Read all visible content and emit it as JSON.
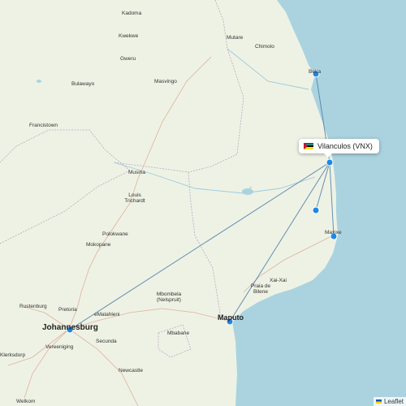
{
  "map": {
    "ocean_color": "#aad3df",
    "land_color": "#eef2e4",
    "route_color": "#4d7da8",
    "marker_color": "#1e88e5"
  },
  "popup": {
    "label": "Vilanculos (VNX)",
    "flag": "Mozambique flag"
  },
  "places": [
    {
      "name": "Kadoma"
    },
    {
      "name": "Kwekwe"
    },
    {
      "name": "Gweru"
    },
    {
      "name": "Bulawayo"
    },
    {
      "name": "Masvingo"
    },
    {
      "name": "Mutare"
    },
    {
      "name": "Chimolo"
    },
    {
      "name": "Beira"
    },
    {
      "name": "Francistown"
    },
    {
      "name": "Musina"
    },
    {
      "name": "Louis Trichardt"
    },
    {
      "name": "Polokwane"
    },
    {
      "name": "Mokopane"
    },
    {
      "name": "Maxixe"
    },
    {
      "name": "Xai-Xai"
    },
    {
      "name": "Praia de Bilene"
    },
    {
      "name": "Mbombela (Nelspruit)"
    },
    {
      "name": "Rustenburg"
    },
    {
      "name": "Pretoria"
    },
    {
      "name": "eMalahleni"
    },
    {
      "name": "Johannesburg"
    },
    {
      "name": "Vereeniging"
    },
    {
      "name": "Secunda"
    },
    {
      "name": "Mbabane"
    },
    {
      "name": "Maputo"
    },
    {
      "name": "Klerksdorp"
    },
    {
      "name": "Newcastle"
    },
    {
      "name": "Welkom"
    }
  ],
  "attribution": {
    "label": "Leaflet"
  }
}
